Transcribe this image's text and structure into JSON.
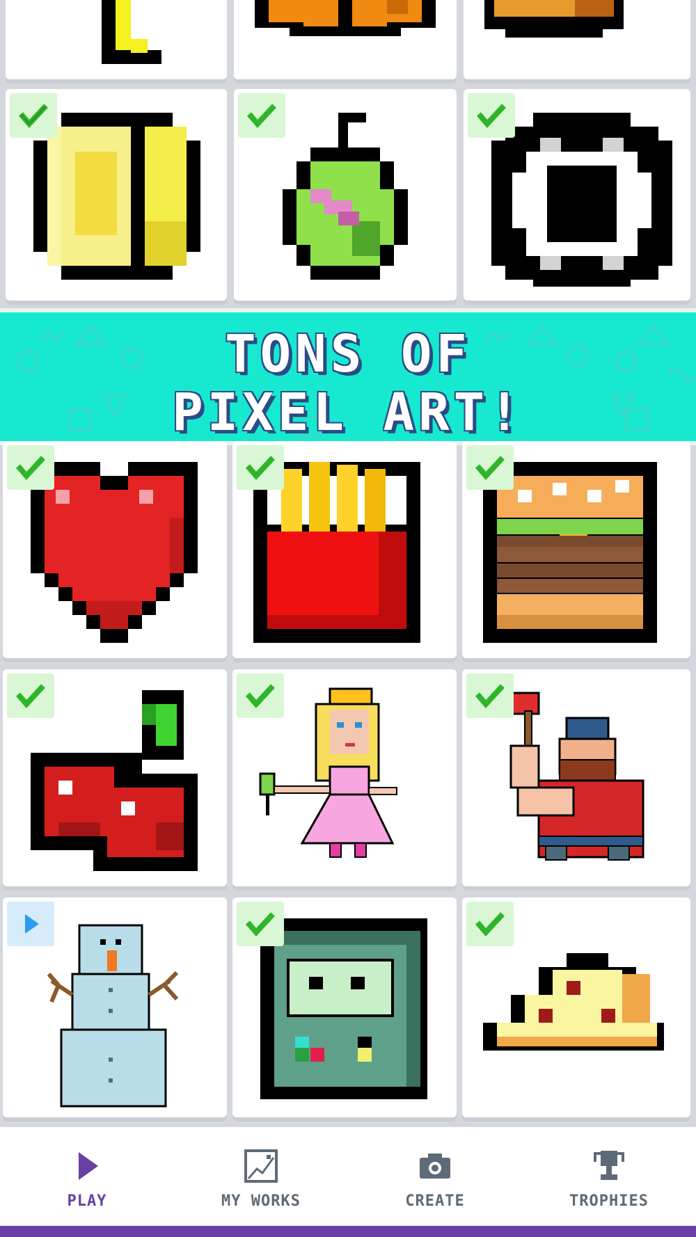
{
  "banner": {
    "line1": "TONS OF",
    "line2": "PIXEL ART!"
  },
  "gallery": {
    "rows": [
      [
        {
          "subject": "letter-l",
          "status": "none"
        },
        {
          "subject": "orange-fruit",
          "status": "none"
        },
        {
          "subject": "pie",
          "status": "none"
        }
      ],
      [
        {
          "subject": "lemon",
          "status": "completed"
        },
        {
          "subject": "pear",
          "status": "completed"
        },
        {
          "subject": "soccer-ball",
          "status": "completed"
        }
      ],
      [
        {
          "subject": "heart",
          "status": "completed"
        },
        {
          "subject": "fries",
          "status": "completed"
        },
        {
          "subject": "burger",
          "status": "completed"
        }
      ],
      [
        {
          "subject": "cherries",
          "status": "completed"
        },
        {
          "subject": "princess",
          "status": "completed"
        },
        {
          "subject": "lumberjack",
          "status": "completed"
        }
      ],
      [
        {
          "subject": "snowman",
          "status": "in-progress"
        },
        {
          "subject": "robot",
          "status": "completed"
        },
        {
          "subject": "pizza",
          "status": "completed"
        }
      ]
    ]
  },
  "nav": {
    "items": [
      {
        "label": "PLAY",
        "icon": "play-icon",
        "active": true
      },
      {
        "label": "MY WORKS",
        "icon": "my-works-icon",
        "active": false
      },
      {
        "label": "CREATE",
        "icon": "camera-icon",
        "active": false
      },
      {
        "label": "TROPHIES",
        "icon": "trophy-icon",
        "active": false
      }
    ]
  },
  "colors": {
    "accent": "#6a3fa3",
    "banner": "#16e9cf",
    "check": "#2fb52a",
    "play": "#2c9df0"
  }
}
